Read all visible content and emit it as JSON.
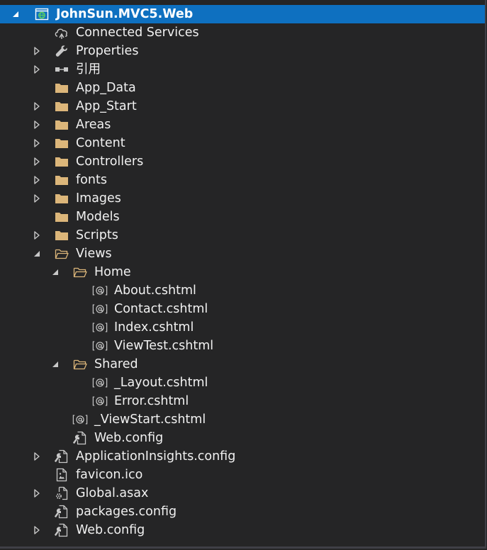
{
  "project": {
    "label": "JohnSun.MVC5.Web",
    "expanded": true,
    "selected": true
  },
  "nodes": [
    {
      "label": "Connected Services",
      "icon": "connected-services-icon",
      "depth": 1,
      "expander": "none"
    },
    {
      "label": "Properties",
      "icon": "wrench-icon",
      "depth": 1,
      "expander": "collapsed"
    },
    {
      "label": "引用",
      "icon": "references-icon",
      "depth": 1,
      "expander": "collapsed"
    },
    {
      "label": "App_Data",
      "icon": "folder-icon",
      "depth": 1,
      "expander": "none"
    },
    {
      "label": "App_Start",
      "icon": "folder-icon",
      "depth": 1,
      "expander": "collapsed"
    },
    {
      "label": "Areas",
      "icon": "folder-icon",
      "depth": 1,
      "expander": "collapsed"
    },
    {
      "label": "Content",
      "icon": "folder-icon",
      "depth": 1,
      "expander": "collapsed"
    },
    {
      "label": "Controllers",
      "icon": "folder-icon",
      "depth": 1,
      "expander": "collapsed"
    },
    {
      "label": "fonts",
      "icon": "folder-icon",
      "depth": 1,
      "expander": "collapsed"
    },
    {
      "label": "Images",
      "icon": "folder-icon",
      "depth": 1,
      "expander": "collapsed"
    },
    {
      "label": "Models",
      "icon": "folder-icon",
      "depth": 1,
      "expander": "none"
    },
    {
      "label": "Scripts",
      "icon": "folder-icon",
      "depth": 1,
      "expander": "collapsed"
    },
    {
      "label": "Views",
      "icon": "folder-open-icon",
      "depth": 1,
      "expander": "expanded"
    },
    {
      "label": "Home",
      "icon": "folder-open-icon",
      "depth": 2,
      "expander": "expanded"
    },
    {
      "label": "About.cshtml",
      "icon": "razor-file-icon",
      "depth": 3,
      "expander": "none"
    },
    {
      "label": "Contact.cshtml",
      "icon": "razor-file-icon",
      "depth": 3,
      "expander": "none"
    },
    {
      "label": "Index.cshtml",
      "icon": "razor-file-icon",
      "depth": 3,
      "expander": "none"
    },
    {
      "label": "ViewTest.cshtml",
      "icon": "razor-file-icon",
      "depth": 3,
      "expander": "none"
    },
    {
      "label": "Shared",
      "icon": "folder-open-icon",
      "depth": 2,
      "expander": "expanded"
    },
    {
      "label": "_Layout.cshtml",
      "icon": "razor-file-icon",
      "depth": 3,
      "expander": "none"
    },
    {
      "label": "Error.cshtml",
      "icon": "razor-file-icon",
      "depth": 3,
      "expander": "none"
    },
    {
      "label": "_ViewStart.cshtml",
      "icon": "razor-file-icon",
      "depth": 2,
      "expander": "none"
    },
    {
      "label": "Web.config",
      "icon": "config-file-icon",
      "depth": 2,
      "expander": "none"
    },
    {
      "label": "ApplicationInsights.config",
      "icon": "config-file-icon",
      "depth": 1,
      "expander": "collapsed"
    },
    {
      "label": "favicon.ico",
      "icon": "icon-file-icon",
      "depth": 1,
      "expander": "none"
    },
    {
      "label": "Global.asax",
      "icon": "asax-file-icon",
      "depth": 1,
      "expander": "collapsed"
    },
    {
      "label": "packages.config",
      "icon": "config-file-icon",
      "depth": 1,
      "expander": "none"
    },
    {
      "label": "Web.config",
      "icon": "config-file-icon",
      "depth": 1,
      "expander": "collapsed"
    }
  ],
  "colors": {
    "background": "#252526",
    "selection": "#0e70c0",
    "text": "#f1f1f1",
    "folder": "#dcb67a",
    "glyph": "#c8c8c8"
  }
}
